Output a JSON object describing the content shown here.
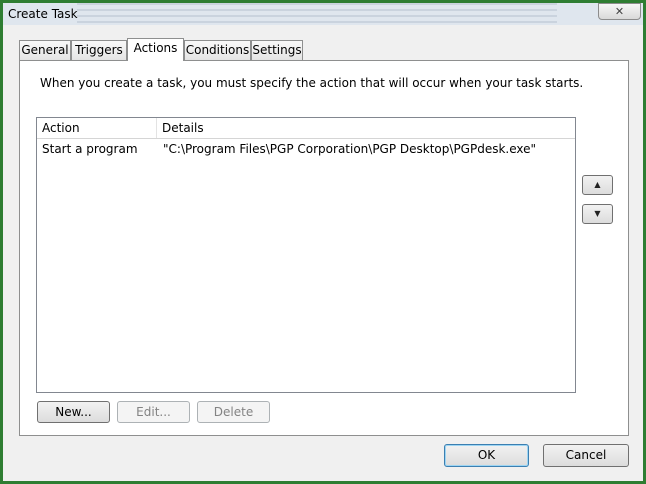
{
  "window": {
    "title": "Create Task",
    "close_glyph": "✕"
  },
  "tabs": [
    {
      "label": "General"
    },
    {
      "label": "Triggers"
    },
    {
      "label": "Actions",
      "active": true
    },
    {
      "label": "Conditions"
    },
    {
      "label": "Settings"
    }
  ],
  "actions_panel": {
    "description": "When you create a task, you must specify the action that will occur when your task starts.",
    "columns": {
      "action": "Action",
      "details": "Details"
    },
    "rows": [
      {
        "action": "Start a program",
        "details": "\"C:\\Program Files\\PGP Corporation\\PGP Desktop\\PGPdesk.exe\""
      }
    ],
    "buttons": {
      "new": "New...",
      "edit": "Edit...",
      "delete": "Delete"
    },
    "move_up_icon": "▲",
    "move_down_icon": "▼"
  },
  "footer": {
    "ok": "OK",
    "cancel": "Cancel"
  },
  "colors": {
    "frame": "#2e7d32",
    "default_button_border": "#3c7fb1"
  }
}
